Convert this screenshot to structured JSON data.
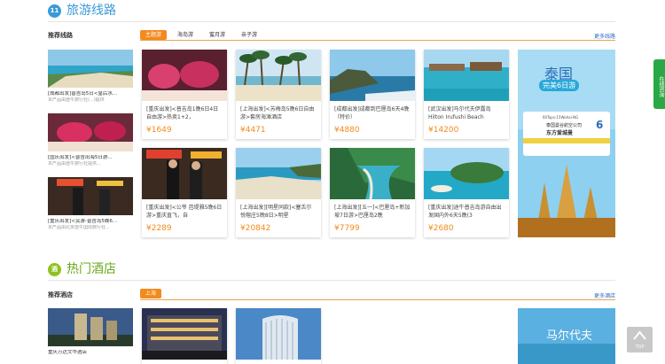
{
  "travel": {
    "icon_text": "11",
    "title": "旅游线路",
    "sub_label": "推荐线路",
    "tabs": [
      "主题游",
      "海岛游",
      "蜜月游",
      "亲子游"
    ],
    "more": "更多线路",
    "left_items": [
      {
        "title": "[成都出发]普吉岛5日<皇后水...",
        "desc": "本产品由途牛旅行社(...)提供"
      },
      {
        "title": "[国庆出发]<普吉出海5日游...",
        "desc": "本产品由途牛旅行社提供..."
      },
      {
        "title": "[重庆出发]<赏游-普吉岛5晚6...",
        "desc": "本产品由北京途牛国际旅行社..."
      }
    ],
    "cards": [
      {
        "title": "[重庆出发]<普吉岛1晚6日4日自由游>热卖1+2，",
        "price": "¥1649"
      },
      {
        "title": "[上海出发]<苏梅岛5晚6日自由游>套房海滩酒店",
        "price": "¥4471"
      },
      {
        "title": "[成都出发]成都到巴厘岛6天4晚（特价）",
        "price": "¥4880"
      },
      {
        "title": "[武汉出发]马尔代夫伊露岛 Hilton Irufushi Beach",
        "price": "¥14200"
      },
      {
        "title": "[重庆出发]<公爷 芭堤雅5晚6日游>重庆直飞，自",
        "price": "¥2289"
      },
      {
        "title": "[上海出发][明星同款]<塞舌尔悦榕庄5晚8日>明星",
        "price": "¥20842"
      },
      {
        "title": "[上海出发][五一]<巴厘岛+新加坡7日游>巴厘岛2晚",
        "price": "¥7799"
      },
      {
        "title": "[重庆出发]途牛普吉岛游自由出发国内外6天5晚(3",
        "price": "¥2680"
      }
    ],
    "banner": {
      "title": "泰国",
      "subtitle": "完美6日游",
      "ticket_code": "60Tops-15Wohai-NG",
      "ticket_line1": "泰国曼谷航空公司",
      "ticket_line2": "东方爱城曼",
      "ticket_num": "6"
    }
  },
  "hotel": {
    "icon_text": "酒",
    "title": "热门酒店",
    "sub_label": "推荐酒店",
    "tabs": [
      "上海"
    ],
    "more": "更多酒店",
    "left_items": [
      {
        "title": "重庆万达文华酒店",
        "desc": ""
      }
    ],
    "banner": {
      "title": "马尔代夫"
    }
  },
  "sidebar": {
    "label": "在线咨询"
  },
  "top_button": {
    "label": "TOP"
  },
  "colors": {
    "accent": "#f28a1d",
    "green": "#2aa845",
    "travel_icon": "#3a9ad8",
    "hotel_icon": "#8dc21f"
  }
}
